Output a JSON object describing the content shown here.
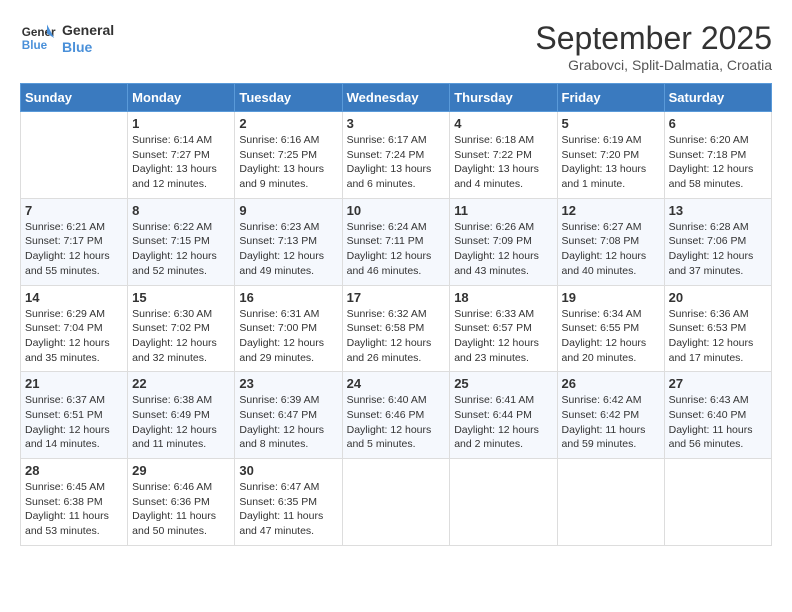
{
  "header": {
    "logo_line1": "General",
    "logo_line2": "Blue",
    "month": "September 2025",
    "location": "Grabovci, Split-Dalmatia, Croatia"
  },
  "weekdays": [
    "Sunday",
    "Monday",
    "Tuesday",
    "Wednesday",
    "Thursday",
    "Friday",
    "Saturday"
  ],
  "weeks": [
    [
      {
        "day": "",
        "info": ""
      },
      {
        "day": "1",
        "info": "Sunrise: 6:14 AM\nSunset: 7:27 PM\nDaylight: 13 hours\nand 12 minutes."
      },
      {
        "day": "2",
        "info": "Sunrise: 6:16 AM\nSunset: 7:25 PM\nDaylight: 13 hours\nand 9 minutes."
      },
      {
        "day": "3",
        "info": "Sunrise: 6:17 AM\nSunset: 7:24 PM\nDaylight: 13 hours\nand 6 minutes."
      },
      {
        "day": "4",
        "info": "Sunrise: 6:18 AM\nSunset: 7:22 PM\nDaylight: 13 hours\nand 4 minutes."
      },
      {
        "day": "5",
        "info": "Sunrise: 6:19 AM\nSunset: 7:20 PM\nDaylight: 13 hours\nand 1 minute."
      },
      {
        "day": "6",
        "info": "Sunrise: 6:20 AM\nSunset: 7:18 PM\nDaylight: 12 hours\nand 58 minutes."
      }
    ],
    [
      {
        "day": "7",
        "info": "Sunrise: 6:21 AM\nSunset: 7:17 PM\nDaylight: 12 hours\nand 55 minutes."
      },
      {
        "day": "8",
        "info": "Sunrise: 6:22 AM\nSunset: 7:15 PM\nDaylight: 12 hours\nand 52 minutes."
      },
      {
        "day": "9",
        "info": "Sunrise: 6:23 AM\nSunset: 7:13 PM\nDaylight: 12 hours\nand 49 minutes."
      },
      {
        "day": "10",
        "info": "Sunrise: 6:24 AM\nSunset: 7:11 PM\nDaylight: 12 hours\nand 46 minutes."
      },
      {
        "day": "11",
        "info": "Sunrise: 6:26 AM\nSunset: 7:09 PM\nDaylight: 12 hours\nand 43 minutes."
      },
      {
        "day": "12",
        "info": "Sunrise: 6:27 AM\nSunset: 7:08 PM\nDaylight: 12 hours\nand 40 minutes."
      },
      {
        "day": "13",
        "info": "Sunrise: 6:28 AM\nSunset: 7:06 PM\nDaylight: 12 hours\nand 37 minutes."
      }
    ],
    [
      {
        "day": "14",
        "info": "Sunrise: 6:29 AM\nSunset: 7:04 PM\nDaylight: 12 hours\nand 35 minutes."
      },
      {
        "day": "15",
        "info": "Sunrise: 6:30 AM\nSunset: 7:02 PM\nDaylight: 12 hours\nand 32 minutes."
      },
      {
        "day": "16",
        "info": "Sunrise: 6:31 AM\nSunset: 7:00 PM\nDaylight: 12 hours\nand 29 minutes."
      },
      {
        "day": "17",
        "info": "Sunrise: 6:32 AM\nSunset: 6:58 PM\nDaylight: 12 hours\nand 26 minutes."
      },
      {
        "day": "18",
        "info": "Sunrise: 6:33 AM\nSunset: 6:57 PM\nDaylight: 12 hours\nand 23 minutes."
      },
      {
        "day": "19",
        "info": "Sunrise: 6:34 AM\nSunset: 6:55 PM\nDaylight: 12 hours\nand 20 minutes."
      },
      {
        "day": "20",
        "info": "Sunrise: 6:36 AM\nSunset: 6:53 PM\nDaylight: 12 hours\nand 17 minutes."
      }
    ],
    [
      {
        "day": "21",
        "info": "Sunrise: 6:37 AM\nSunset: 6:51 PM\nDaylight: 12 hours\nand 14 minutes."
      },
      {
        "day": "22",
        "info": "Sunrise: 6:38 AM\nSunset: 6:49 PM\nDaylight: 12 hours\nand 11 minutes."
      },
      {
        "day": "23",
        "info": "Sunrise: 6:39 AM\nSunset: 6:47 PM\nDaylight: 12 hours\nand 8 minutes."
      },
      {
        "day": "24",
        "info": "Sunrise: 6:40 AM\nSunset: 6:46 PM\nDaylight: 12 hours\nand 5 minutes."
      },
      {
        "day": "25",
        "info": "Sunrise: 6:41 AM\nSunset: 6:44 PM\nDaylight: 12 hours\nand 2 minutes."
      },
      {
        "day": "26",
        "info": "Sunrise: 6:42 AM\nSunset: 6:42 PM\nDaylight: 11 hours\nand 59 minutes."
      },
      {
        "day": "27",
        "info": "Sunrise: 6:43 AM\nSunset: 6:40 PM\nDaylight: 11 hours\nand 56 minutes."
      }
    ],
    [
      {
        "day": "28",
        "info": "Sunrise: 6:45 AM\nSunset: 6:38 PM\nDaylight: 11 hours\nand 53 minutes."
      },
      {
        "day": "29",
        "info": "Sunrise: 6:46 AM\nSunset: 6:36 PM\nDaylight: 11 hours\nand 50 minutes."
      },
      {
        "day": "30",
        "info": "Sunrise: 6:47 AM\nSunset: 6:35 PM\nDaylight: 11 hours\nand 47 minutes."
      },
      {
        "day": "",
        "info": ""
      },
      {
        "day": "",
        "info": ""
      },
      {
        "day": "",
        "info": ""
      },
      {
        "day": "",
        "info": ""
      }
    ]
  ]
}
